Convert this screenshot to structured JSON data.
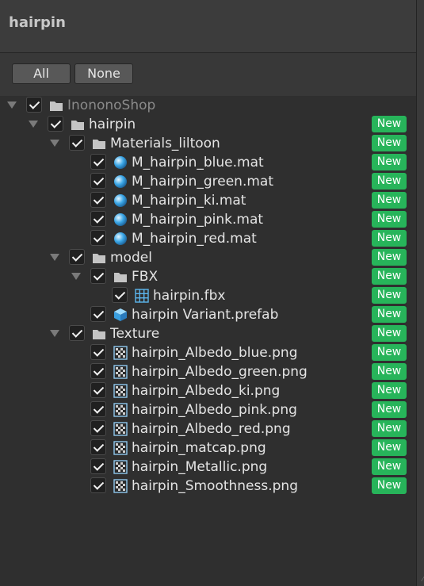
{
  "window": {
    "title": "hairpin"
  },
  "toolbar": {
    "all_label": "All",
    "none_label": "None"
  },
  "badge_color": "#27b45a",
  "tree": [
    {
      "label": "InononoShop",
      "depth": 0,
      "icon": "folder-icon",
      "expanded": true,
      "checked": true,
      "dim": true,
      "badge": ""
    },
    {
      "label": "hairpin",
      "depth": 1,
      "icon": "folder-icon",
      "expanded": true,
      "checked": true,
      "badge": "New"
    },
    {
      "label": "Materials_liltoon",
      "depth": 2,
      "icon": "folder-icon",
      "expanded": true,
      "checked": true,
      "badge": "New"
    },
    {
      "label": "M_hairpin_blue.mat",
      "depth": 3,
      "icon": "material-sphere-icon",
      "checked": true,
      "badge": "New"
    },
    {
      "label": "M_hairpin_green.mat",
      "depth": 3,
      "icon": "material-sphere-icon",
      "checked": true,
      "badge": "New"
    },
    {
      "label": "M_hairpin_ki.mat",
      "depth": 3,
      "icon": "material-sphere-icon",
      "checked": true,
      "badge": "New"
    },
    {
      "label": "M_hairpin_pink.mat",
      "depth": 3,
      "icon": "material-sphere-icon",
      "checked": true,
      "badge": "New"
    },
    {
      "label": "M_hairpin_red.mat",
      "depth": 3,
      "icon": "material-sphere-icon",
      "checked": true,
      "badge": "New"
    },
    {
      "label": "model",
      "depth": 2,
      "icon": "folder-icon",
      "expanded": true,
      "checked": true,
      "badge": "New"
    },
    {
      "label": "FBX",
      "depth": 3,
      "icon": "folder-icon",
      "expanded": true,
      "checked": true,
      "badge": "New"
    },
    {
      "label": "hairpin.fbx",
      "depth": 4,
      "icon": "mesh-grid-icon",
      "checked": true,
      "badge": "New"
    },
    {
      "label": "hairpin Variant.prefab",
      "depth": 3,
      "icon": "prefab-cube-icon",
      "checked": true,
      "badge": "New"
    },
    {
      "label": "Texture",
      "depth": 2,
      "icon": "folder-icon",
      "expanded": true,
      "checked": true,
      "badge": "New"
    },
    {
      "label": "hairpin_Albedo_blue.png",
      "depth": 3,
      "icon": "texture-icon",
      "checked": true,
      "badge": "New"
    },
    {
      "label": "hairpin_Albedo_green.png",
      "depth": 3,
      "icon": "texture-icon",
      "checked": true,
      "badge": "New"
    },
    {
      "label": "hairpin_Albedo_ki.png",
      "depth": 3,
      "icon": "texture-icon",
      "checked": true,
      "badge": "New"
    },
    {
      "label": "hairpin_Albedo_pink.png",
      "depth": 3,
      "icon": "texture-icon",
      "checked": true,
      "badge": "New"
    },
    {
      "label": "hairpin_Albedo_red.png",
      "depth": 3,
      "icon": "texture-icon",
      "checked": true,
      "badge": "New"
    },
    {
      "label": "hairpin_matcap.png",
      "depth": 3,
      "icon": "texture-icon",
      "checked": true,
      "badge": "New"
    },
    {
      "label": "hairpin_Metallic.png",
      "depth": 3,
      "icon": "texture-icon",
      "checked": true,
      "badge": "New"
    },
    {
      "label": "hairpin_Smoothness.png",
      "depth": 3,
      "icon": "texture-icon",
      "checked": true,
      "badge": "New"
    }
  ]
}
